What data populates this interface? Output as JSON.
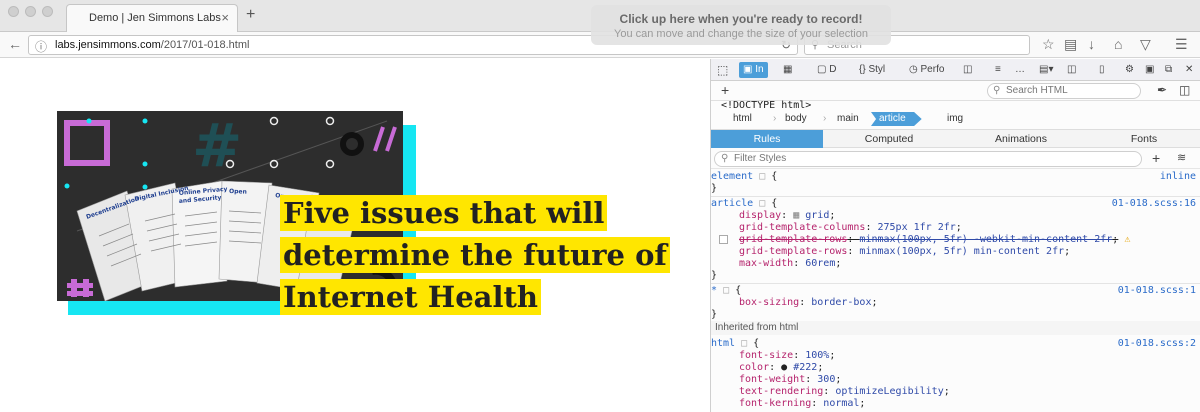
{
  "browser": {
    "tab_title": "Demo | Jen Simmons Labs",
    "tab_close": "×",
    "new_tab": "+",
    "url_host": "labs.jensimmons.com",
    "url_path": "/2017/01-018.html",
    "search_placeholder": "Search"
  },
  "recording_overlay": {
    "title": "Click up here when you're ready to record!",
    "subtitle": "You can move and change the size of your selection"
  },
  "page": {
    "headline_lines": [
      "Five issues that will",
      "determine the future of",
      "Internet Health"
    ]
  },
  "devtools": {
    "tabs": [
      "In",
      "",
      "D",
      "Styl",
      "Perfo",
      "",
      "",
      ""
    ],
    "search_html_placeholder": "Search HTML",
    "doctype": "<!DOCTYPE html>",
    "breadcrumbs": [
      "html",
      "body",
      "main",
      "article",
      "img"
    ],
    "sub_tabs": [
      "Rules",
      "Computed",
      "Animations",
      "Fonts"
    ],
    "filter_placeholder": "Filter Styles",
    "rules": {
      "element_sel": "element",
      "element_src": "inline",
      "article_sel": "article",
      "article_src": "01-018.scss:16",
      "article_props": [
        {
          "p": "display",
          "v": "grid"
        },
        {
          "p": "grid-template-columns",
          "v": "275px 1fr 2fr"
        },
        {
          "p": "grid-template-rows",
          "v": "minmax(100px, 5fr) -webkit-min-content 2fr"
        },
        {
          "p": "grid-template-rows",
          "v": "minmax(100px, 5fr) min-content 2fr"
        },
        {
          "p": "max-width",
          "v": "60rem"
        }
      ],
      "star_sel": "*",
      "star_src": "01-018.scss:1",
      "star_props": [
        {
          "p": "box-sizing",
          "v": "border-box"
        }
      ],
      "inherited_label": "Inherited from html",
      "html_sel": "html",
      "html_src": "01-018.scss:2",
      "html_props": [
        {
          "p": "font-size",
          "v": "100%"
        },
        {
          "p": "color",
          "v": "#222"
        },
        {
          "p": "font-weight",
          "v": "300"
        },
        {
          "p": "text-rendering",
          "v": "optimizeLegibility"
        },
        {
          "p": "font-kerning",
          "v": "normal"
        }
      ]
    }
  },
  "colors": {
    "highlight": "#ffe600",
    "cyan": "#16e6f2",
    "accent": "#4c9ed9"
  }
}
